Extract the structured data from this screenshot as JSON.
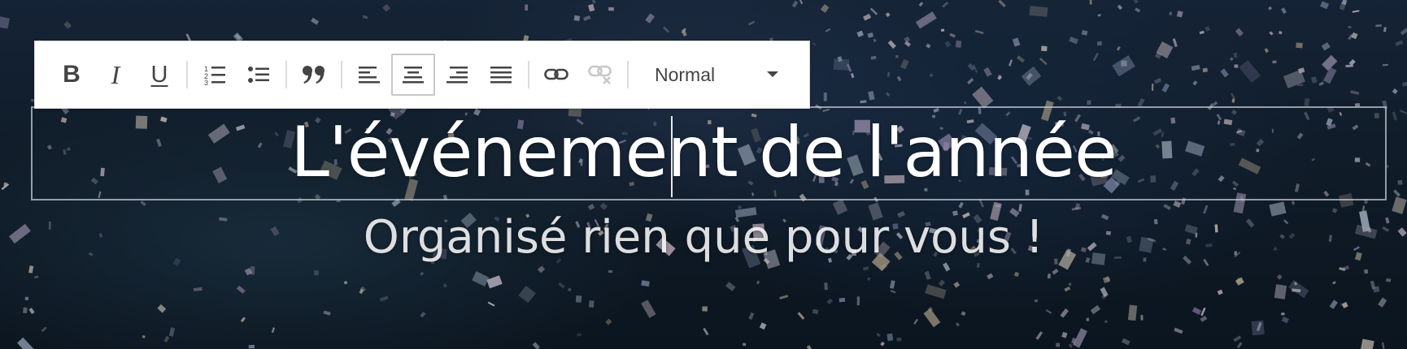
{
  "editor": {
    "toolbar": {
      "buttons": [
        {
          "id": "bold",
          "icon": "bold-icon",
          "glyph": "B",
          "active": false
        },
        {
          "id": "italic",
          "icon": "italic-icon",
          "glyph": "I",
          "active": false
        },
        {
          "id": "underline",
          "icon": "underline-icon",
          "glyph": "U",
          "active": false
        },
        {
          "id": "ordered-list",
          "icon": "ordered-list-icon",
          "active": false
        },
        {
          "id": "bullet-list",
          "icon": "bullet-list-icon",
          "active": false
        },
        {
          "id": "blockquote",
          "icon": "quote-icon",
          "active": false
        },
        {
          "id": "align-left",
          "icon": "align-left-icon",
          "active": false
        },
        {
          "id": "align-center",
          "icon": "align-center-icon",
          "active": true
        },
        {
          "id": "align-right",
          "icon": "align-right-icon",
          "active": false
        },
        {
          "id": "align-justify",
          "icon": "align-justify-icon",
          "active": false
        },
        {
          "id": "link",
          "icon": "link-icon",
          "active": false
        },
        {
          "id": "unlink",
          "icon": "unlink-icon",
          "active": false,
          "disabled": true
        }
      ],
      "style_select": {
        "selected": "Normal",
        "icon": "caret-down-icon"
      }
    }
  },
  "hero": {
    "title": "L'événement de l'année",
    "subtitle": "Organisé rien que pour vous !"
  },
  "colors": {
    "toolbar_bg": "#ffffff",
    "icon": "#444444",
    "icon_disabled": "#c8c8c8",
    "active_border": "#c8c8c8",
    "title_text": "#ffffff",
    "background": "#13202e"
  }
}
